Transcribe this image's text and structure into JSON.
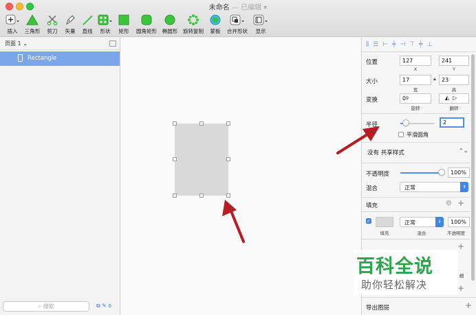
{
  "window": {
    "title": "未命名",
    "subtitle": "— 已编辑"
  },
  "toolbar": {
    "items": [
      {
        "label": "插入",
        "icon": "plus-icon"
      },
      {
        "label": "三角形",
        "icon": "triangle-icon"
      },
      {
        "label": "剪刀",
        "icon": "scissors-icon"
      },
      {
        "label": "矢量",
        "icon": "pen-icon"
      },
      {
        "label": "直线",
        "icon": "line-icon"
      },
      {
        "label": "形状",
        "icon": "shapes-icon"
      },
      {
        "label": "矩形",
        "icon": "rectangle-icon"
      },
      {
        "label": "圆角矩形",
        "icon": "rounded-rectangle-icon"
      },
      {
        "label": "椭圆形",
        "icon": "oval-icon"
      },
      {
        "label": "旋转复制",
        "icon": "rotate-copy-icon"
      },
      {
        "label": "蒙板",
        "icon": "mask-icon"
      },
      {
        "label": "合并形状",
        "icon": "combine-icon"
      },
      {
        "label": "显示",
        "icon": "view-icon"
      }
    ]
  },
  "left_panel": {
    "page_selector": "页面 1",
    "layers": [
      {
        "name": "Rectangle"
      }
    ],
    "search_placeholder": "搜索",
    "footer_count": "0"
  },
  "inspector": {
    "position": {
      "label": "位置",
      "x": "127",
      "y": "241",
      "x_caption": "X",
      "y_caption": "Y"
    },
    "size": {
      "label": "大小",
      "width": "17",
      "height": "23",
      "w_caption": "宽",
      "h_caption": "高"
    },
    "transform": {
      "label": "变换",
      "rotate": "0º",
      "rotate_caption": "旋转",
      "flip_caption": "翻转"
    },
    "radius": {
      "label": "半径",
      "value": "2",
      "slider_fraction": 0.15,
      "smooth_label": "平滑圆角"
    },
    "shared_style": "没有 共享样式",
    "opacity": {
      "label": "不透明度",
      "value": "100%",
      "slider_fraction": 1.0
    },
    "blend": {
      "label": "混合",
      "value": "正常"
    },
    "fill": {
      "section_label": "填充",
      "blend_value": "正常",
      "opacity_value": "100%",
      "captions": [
        "填充",
        "混合",
        "不透明度"
      ]
    },
    "border_caption": "细",
    "export_label": "导出图层"
  },
  "watermark": {
    "line1": "百科全说",
    "line2": "助你轻松解决"
  },
  "colors": {
    "selection": "#7aa6ea",
    "accent": "#3f86e6",
    "arrow": "#b81c22",
    "watermark_green": "#2aa64b",
    "shape_fill": "#d9d9d9"
  }
}
